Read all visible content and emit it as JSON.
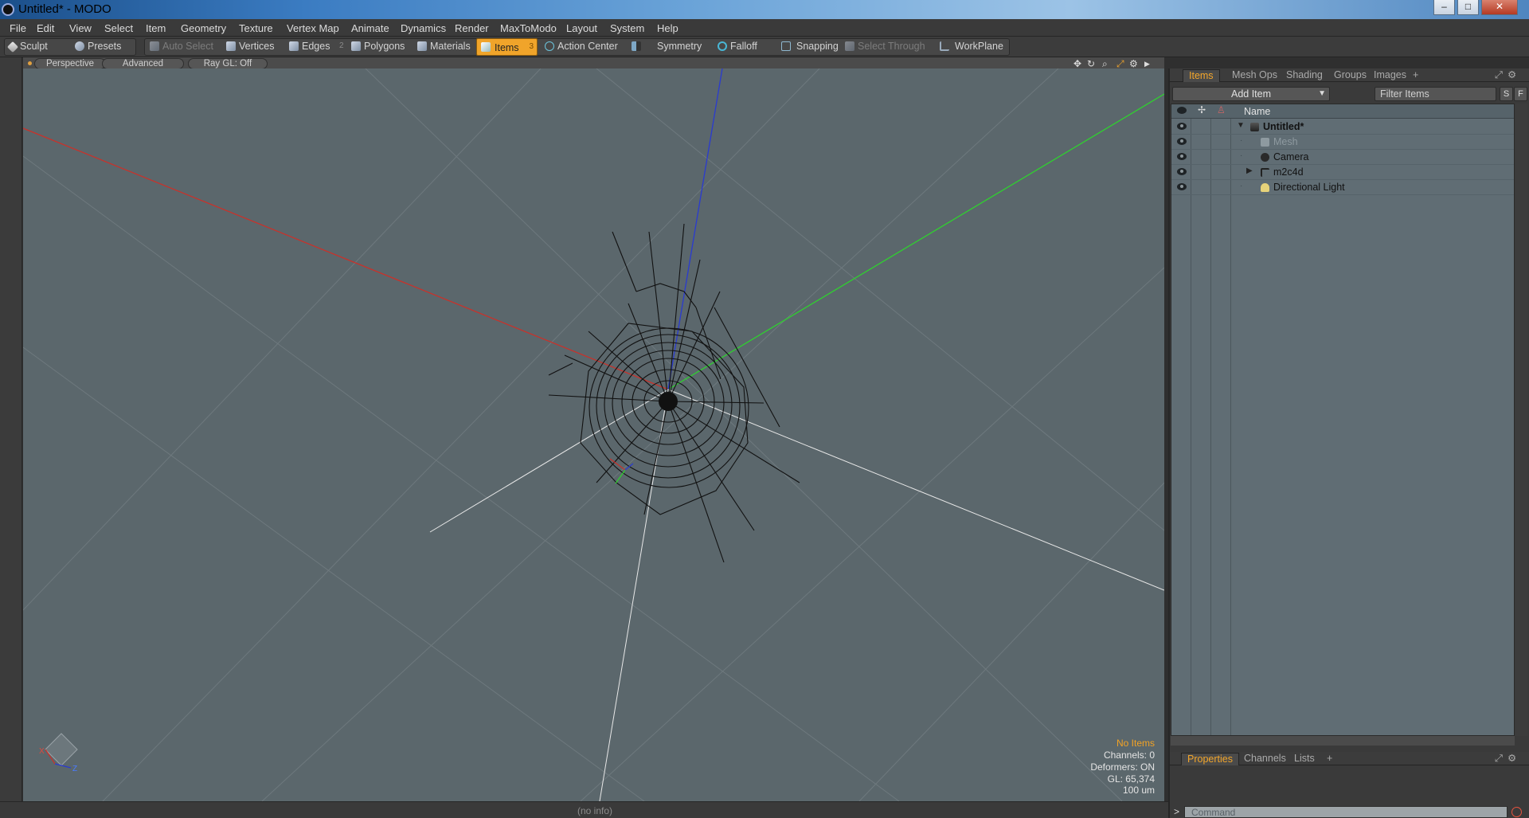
{
  "window": {
    "title": "Untitled* - MODO",
    "buttons": [
      "–",
      "□",
      "✕"
    ]
  },
  "menu": [
    "File",
    "Edit",
    "View",
    "Select",
    "Item",
    "Geometry",
    "Texture",
    "Vertex Map",
    "Animate",
    "Dynamics",
    "Render",
    "MaxToModo",
    "Layout",
    "System",
    "Help"
  ],
  "toolbar": {
    "sculpt": "Sculpt",
    "presets": "Presets",
    "auto_select": "Auto Select",
    "vertices": "Vertices",
    "edges": "Edges",
    "edges_count": "2",
    "polygons": "Polygons",
    "materials": "Materials",
    "items": "Items",
    "items_count": "3",
    "action_center": "Action Center",
    "symmetry": "Symmetry",
    "falloff": "Falloff",
    "snapping": "Snapping",
    "select_through": "Select Through",
    "workplane": "WorkPlane"
  },
  "viewport": {
    "view": "Perspective",
    "shading": "Advanced",
    "raygl": "Ray GL: Off",
    "info": {
      "selection": "No Items",
      "channels": "Channels: 0",
      "deformers": "Deformers: ON",
      "gl": "GL: 65,374",
      "scale": "100 um"
    },
    "status": "(no info)"
  },
  "panel_top": {
    "tabs": [
      "Items",
      "Mesh Ops",
      "Shading",
      "Groups",
      "Images",
      "+"
    ],
    "add_item": "Add Item",
    "filter": "Filter Items",
    "filter_s": "S",
    "filter_f": "F",
    "column_name": "Name",
    "rows": [
      {
        "label": "Untitled*",
        "indent": 0,
        "expand": "▼",
        "kind": "scene"
      },
      {
        "label": "Mesh",
        "indent": 1,
        "expand": "",
        "kind": "mesh"
      },
      {
        "label": "Camera",
        "indent": 1,
        "expand": "",
        "kind": "camera"
      },
      {
        "label": "m2c4d",
        "indent": 1,
        "expand": "▶",
        "kind": "locator"
      },
      {
        "label": "Directional Light",
        "indent": 1,
        "expand": "",
        "kind": "light"
      }
    ]
  },
  "panel_bottom": {
    "tabs": [
      "Properties",
      "Channels",
      "Lists",
      "+"
    ],
    "command_placeholder": "Command",
    "prompt": ">"
  },
  "colors": {
    "accent": "#f0a42a",
    "viewport_bg": "#5b676c",
    "axis_x": "#c8322b",
    "axis_y": "#2fd12f",
    "axis_z": "#2a3bd0"
  }
}
